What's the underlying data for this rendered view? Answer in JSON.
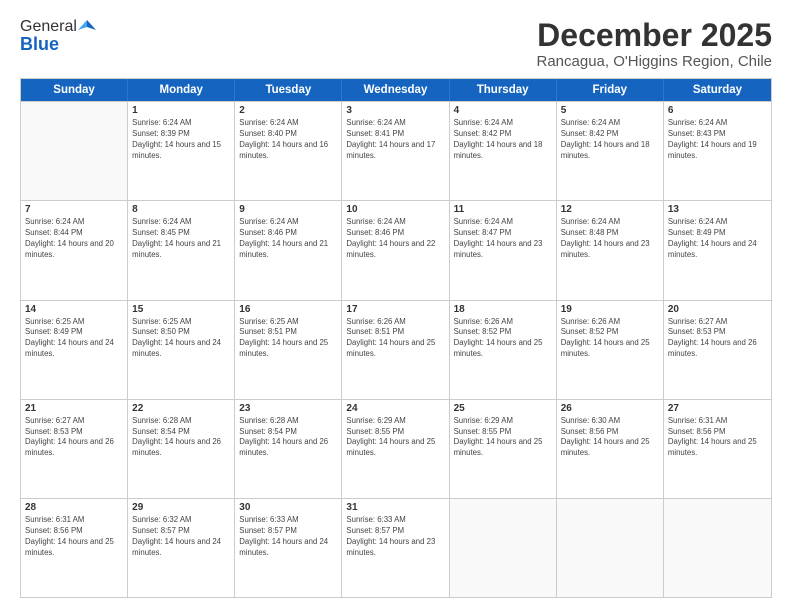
{
  "header": {
    "logo_general": "General",
    "logo_blue": "Blue",
    "month_title": "December 2025",
    "location": "Rancagua, O'Higgins Region, Chile"
  },
  "days_of_week": [
    "Sunday",
    "Monday",
    "Tuesday",
    "Wednesday",
    "Thursday",
    "Friday",
    "Saturday"
  ],
  "weeks": [
    [
      {
        "day": "",
        "empty": true
      },
      {
        "day": "1",
        "sunrise": "Sunrise: 6:24 AM",
        "sunset": "Sunset: 8:39 PM",
        "daylight": "Daylight: 14 hours and 15 minutes."
      },
      {
        "day": "2",
        "sunrise": "Sunrise: 6:24 AM",
        "sunset": "Sunset: 8:40 PM",
        "daylight": "Daylight: 14 hours and 16 minutes."
      },
      {
        "day": "3",
        "sunrise": "Sunrise: 6:24 AM",
        "sunset": "Sunset: 8:41 PM",
        "daylight": "Daylight: 14 hours and 17 minutes."
      },
      {
        "day": "4",
        "sunrise": "Sunrise: 6:24 AM",
        "sunset": "Sunset: 8:42 PM",
        "daylight": "Daylight: 14 hours and 18 minutes."
      },
      {
        "day": "5",
        "sunrise": "Sunrise: 6:24 AM",
        "sunset": "Sunset: 8:42 PM",
        "daylight": "Daylight: 14 hours and 18 minutes."
      },
      {
        "day": "6",
        "sunrise": "Sunrise: 6:24 AM",
        "sunset": "Sunset: 8:43 PM",
        "daylight": "Daylight: 14 hours and 19 minutes."
      }
    ],
    [
      {
        "day": "7",
        "sunrise": "Sunrise: 6:24 AM",
        "sunset": "Sunset: 8:44 PM",
        "daylight": "Daylight: 14 hours and 20 minutes."
      },
      {
        "day": "8",
        "sunrise": "Sunrise: 6:24 AM",
        "sunset": "Sunset: 8:45 PM",
        "daylight": "Daylight: 14 hours and 21 minutes."
      },
      {
        "day": "9",
        "sunrise": "Sunrise: 6:24 AM",
        "sunset": "Sunset: 8:46 PM",
        "daylight": "Daylight: 14 hours and 21 minutes."
      },
      {
        "day": "10",
        "sunrise": "Sunrise: 6:24 AM",
        "sunset": "Sunset: 8:46 PM",
        "daylight": "Daylight: 14 hours and 22 minutes."
      },
      {
        "day": "11",
        "sunrise": "Sunrise: 6:24 AM",
        "sunset": "Sunset: 8:47 PM",
        "daylight": "Daylight: 14 hours and 23 minutes."
      },
      {
        "day": "12",
        "sunrise": "Sunrise: 6:24 AM",
        "sunset": "Sunset: 8:48 PM",
        "daylight": "Daylight: 14 hours and 23 minutes."
      },
      {
        "day": "13",
        "sunrise": "Sunrise: 6:24 AM",
        "sunset": "Sunset: 8:49 PM",
        "daylight": "Daylight: 14 hours and 24 minutes."
      }
    ],
    [
      {
        "day": "14",
        "sunrise": "Sunrise: 6:25 AM",
        "sunset": "Sunset: 8:49 PM",
        "daylight": "Daylight: 14 hours and 24 minutes."
      },
      {
        "day": "15",
        "sunrise": "Sunrise: 6:25 AM",
        "sunset": "Sunset: 8:50 PM",
        "daylight": "Daylight: 14 hours and 24 minutes."
      },
      {
        "day": "16",
        "sunrise": "Sunrise: 6:25 AM",
        "sunset": "Sunset: 8:51 PM",
        "daylight": "Daylight: 14 hours and 25 minutes."
      },
      {
        "day": "17",
        "sunrise": "Sunrise: 6:26 AM",
        "sunset": "Sunset: 8:51 PM",
        "daylight": "Daylight: 14 hours and 25 minutes."
      },
      {
        "day": "18",
        "sunrise": "Sunrise: 6:26 AM",
        "sunset": "Sunset: 8:52 PM",
        "daylight": "Daylight: 14 hours and 25 minutes."
      },
      {
        "day": "19",
        "sunrise": "Sunrise: 6:26 AM",
        "sunset": "Sunset: 8:52 PM",
        "daylight": "Daylight: 14 hours and 25 minutes."
      },
      {
        "day": "20",
        "sunrise": "Sunrise: 6:27 AM",
        "sunset": "Sunset: 8:53 PM",
        "daylight": "Daylight: 14 hours and 26 minutes."
      }
    ],
    [
      {
        "day": "21",
        "sunrise": "Sunrise: 6:27 AM",
        "sunset": "Sunset: 8:53 PM",
        "daylight": "Daylight: 14 hours and 26 minutes."
      },
      {
        "day": "22",
        "sunrise": "Sunrise: 6:28 AM",
        "sunset": "Sunset: 8:54 PM",
        "daylight": "Daylight: 14 hours and 26 minutes."
      },
      {
        "day": "23",
        "sunrise": "Sunrise: 6:28 AM",
        "sunset": "Sunset: 8:54 PM",
        "daylight": "Daylight: 14 hours and 26 minutes."
      },
      {
        "day": "24",
        "sunrise": "Sunrise: 6:29 AM",
        "sunset": "Sunset: 8:55 PM",
        "daylight": "Daylight: 14 hours and 25 minutes."
      },
      {
        "day": "25",
        "sunrise": "Sunrise: 6:29 AM",
        "sunset": "Sunset: 8:55 PM",
        "daylight": "Daylight: 14 hours and 25 minutes."
      },
      {
        "day": "26",
        "sunrise": "Sunrise: 6:30 AM",
        "sunset": "Sunset: 8:56 PM",
        "daylight": "Daylight: 14 hours and 25 minutes."
      },
      {
        "day": "27",
        "sunrise": "Sunrise: 6:31 AM",
        "sunset": "Sunset: 8:56 PM",
        "daylight": "Daylight: 14 hours and 25 minutes."
      }
    ],
    [
      {
        "day": "28",
        "sunrise": "Sunrise: 6:31 AM",
        "sunset": "Sunset: 8:56 PM",
        "daylight": "Daylight: 14 hours and 25 minutes."
      },
      {
        "day": "29",
        "sunrise": "Sunrise: 6:32 AM",
        "sunset": "Sunset: 8:57 PM",
        "daylight": "Daylight: 14 hours and 24 minutes."
      },
      {
        "day": "30",
        "sunrise": "Sunrise: 6:33 AM",
        "sunset": "Sunset: 8:57 PM",
        "daylight": "Daylight: 14 hours and 24 minutes."
      },
      {
        "day": "31",
        "sunrise": "Sunrise: 6:33 AM",
        "sunset": "Sunset: 8:57 PM",
        "daylight": "Daylight: 14 hours and 23 minutes."
      },
      {
        "day": "",
        "empty": true
      },
      {
        "day": "",
        "empty": true
      },
      {
        "day": "",
        "empty": true
      }
    ]
  ]
}
